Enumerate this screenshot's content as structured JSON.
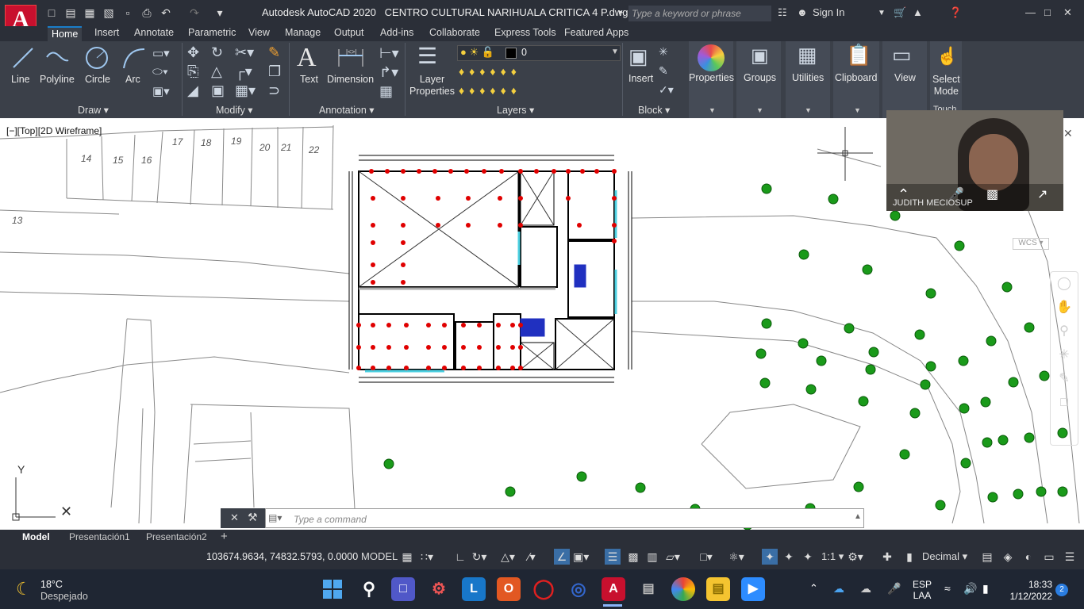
{
  "title_bar": {
    "app_title": "Autodesk AutoCAD 2020",
    "file_name": "CENTRO CULTURAL NARIHUALA CRITICA 4 P.dwg",
    "search_placeholder": "Type a keyword or phrase",
    "sign_in": "Sign In",
    "logo": "A"
  },
  "ribbon_tabs": [
    "Home",
    "Insert",
    "Annotate",
    "Parametric",
    "View",
    "Manage",
    "Output",
    "Add-ins",
    "Collaborate",
    "Express Tools",
    "Featured Apps"
  ],
  "ribbon": {
    "draw": {
      "line": "Line",
      "polyline": "Polyline",
      "circle": "Circle",
      "arc": "Arc",
      "label": "Draw"
    },
    "modify": {
      "label": "Modify"
    },
    "annotation": {
      "text": "Text",
      "dimension": "Dimension",
      "label": "Annotation"
    },
    "layers": {
      "layer_properties": "Layer\nProperties",
      "current_layer": "0",
      "label": "Layers"
    },
    "block": {
      "insert": "Insert",
      "label": "Block"
    },
    "properties": "Properties",
    "groups": "Groups",
    "utilities": "Utilities",
    "clipboard": "Clipboard",
    "view": "View",
    "select_mode": "Select\nMode",
    "touch": "Touch"
  },
  "viewport": {
    "view_label": "[−][Top][2D Wireframe]",
    "wcs": "WCS",
    "lot_numbers": [
      "17",
      "18",
      "19",
      "20",
      "21",
      "22",
      "14",
      "15",
      "16",
      "13"
    ],
    "axis_y": "Y"
  },
  "webcam": {
    "participant": "JUDITH MECIOSUP"
  },
  "command_line": {
    "placeholder": "Type a command"
  },
  "layout_tabs": [
    "Model",
    "Presentación1",
    "Presentación2"
  ],
  "status_bar": {
    "coordinates": "103674.9634, 74832.5793, 0.0000",
    "space": "MODEL",
    "scale": "1:1",
    "units": "Decimal"
  },
  "taskbar": {
    "weather_temp": "18°C",
    "weather_desc": "Despejado",
    "lang": "ESP",
    "lang_sub": "LAA",
    "time": "18:33",
    "date": "1/12/2022",
    "notifications": "2"
  },
  "colors": {
    "accent": "#1a7dc9",
    "autocad_red": "#c8102e",
    "tree": "#1a9a1a",
    "column": "#e00000"
  }
}
